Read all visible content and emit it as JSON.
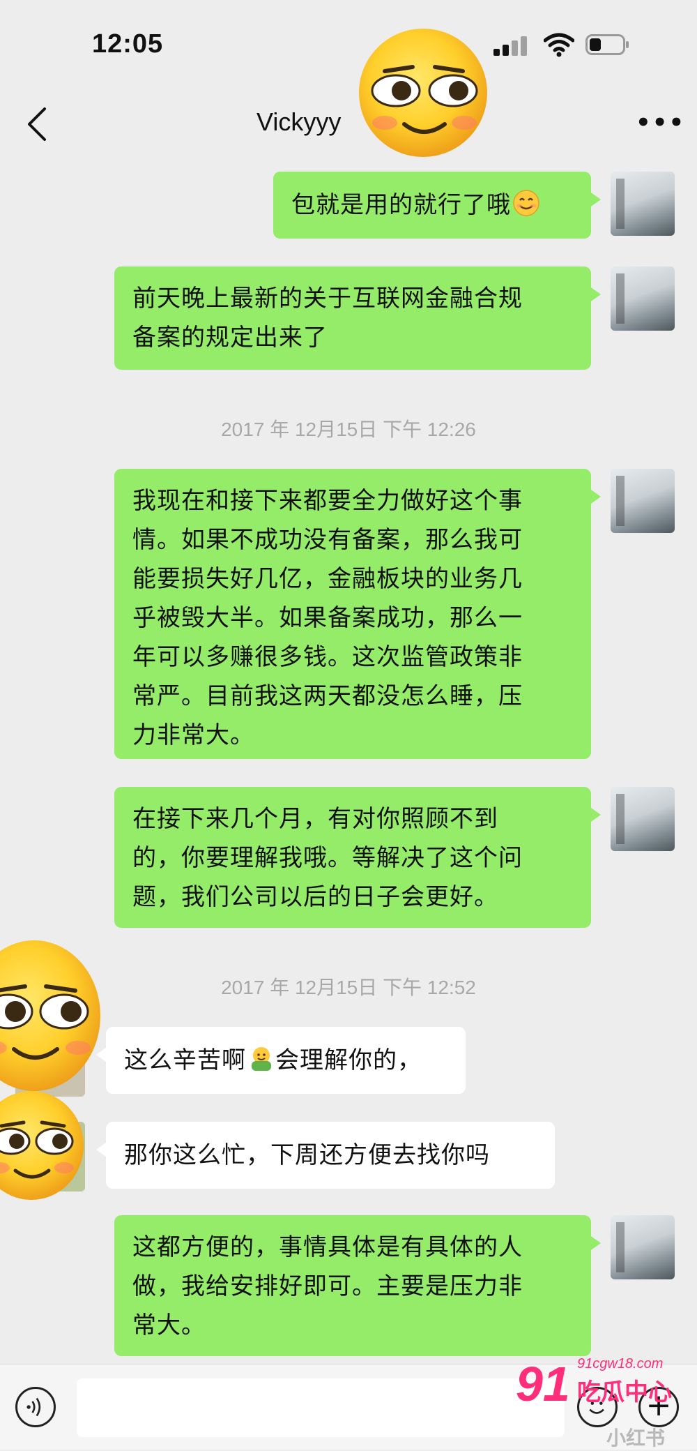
{
  "status_bar": {
    "time": "12:05"
  },
  "header": {
    "title": "Vickyyy"
  },
  "messages": [
    {
      "sender": "me",
      "text": "包就是用的就行了哦"
    },
    {
      "sender": "me",
      "lines": [
        "前天晚上最新的关于互联网金融合规",
        "备案的规定出来了"
      ]
    },
    {
      "sender": "me",
      "lines": [
        "我现在和接下来都要全力做好这个事",
        "情。如果不成功没有备案，那么我可",
        "能要损失好几亿，金融板块的业务几",
        "乎被毁大半。如果备案成功，那么一",
        "年可以多赚很多钱。这次监管政策非",
        "常严。目前我这两天都没怎么睡，压",
        "力非常大。"
      ]
    },
    {
      "sender": "me",
      "lines": [
        "在接下来几个月，有对你照顾不到",
        "的，你要理解我哦。等解决了这个问",
        "题，我们公司以后的日子会更好。"
      ]
    },
    {
      "sender": "them",
      "text_before": "这么辛苦啊",
      "text_after": "会理解你的，"
    },
    {
      "sender": "them",
      "text": "那你这么忙，下周还方便去找你吗"
    },
    {
      "sender": "me",
      "lines": [
        "这都方便的，事情具体是有具体的人",
        "做，我给安排好即可。主要是压力非",
        "常大。"
      ]
    }
  ],
  "timestamps": [
    "2017 年 12月15日 下午 12:26",
    "2017 年 12月15日 下午 12:52"
  ],
  "watermark": {
    "number": "91",
    "site": "91cgw18.com",
    "name": "吃瓜中心",
    "corner": "小红书"
  },
  "colors": {
    "background": "#ededed",
    "my_bubble": "#95ec69",
    "their_bubble": "#ffffff",
    "watermark": "#ff2d7a"
  },
  "icons": {
    "back": "chevron-left-icon",
    "more": "more-icon",
    "voice": "voice-icon",
    "emoji": "emoji-icon",
    "plus": "plus-icon"
  }
}
